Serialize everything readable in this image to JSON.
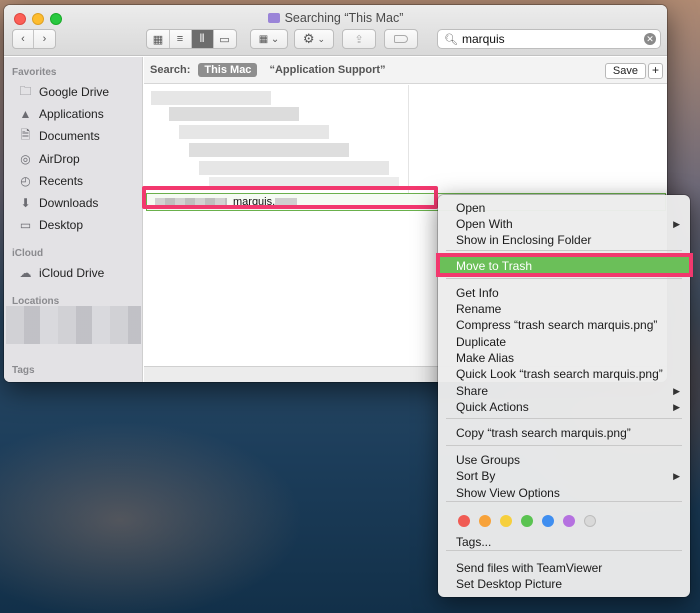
{
  "window": {
    "title": "Searching “This Mac”"
  },
  "search": {
    "value": "marquis",
    "clear_glyph": "✕"
  },
  "scope": {
    "label": "Search:",
    "this_mac": "This Mac",
    "other": "“Application Support”",
    "save": "Save",
    "add": "+"
  },
  "sidebar": {
    "favorites_header": "Favorites",
    "favorites": [
      {
        "label": "Google Drive",
        "icon": "folder-icon"
      },
      {
        "label": "Applications",
        "icon": "applications-icon"
      },
      {
        "label": "Documents",
        "icon": "document-icon"
      },
      {
        "label": "AirDrop",
        "icon": "airdrop-icon"
      },
      {
        "label": "Recents",
        "icon": "clock-icon"
      },
      {
        "label": "Downloads",
        "icon": "download-icon"
      },
      {
        "label": "Desktop",
        "icon": "desktop-icon"
      }
    ],
    "icloud_header": "iCloud",
    "icloud": [
      {
        "label": "iCloud Drive",
        "icon": "cloud-icon"
      }
    ],
    "locations_header": "Locations",
    "tags_header": "Tags"
  },
  "results": {
    "selected_file": "marquis."
  },
  "context_menu": {
    "groups": [
      [
        {
          "label": "Open",
          "submenu": false
        },
        {
          "label": "Open With",
          "submenu": true
        },
        {
          "label": "Show in Enclosing Folder",
          "submenu": false
        }
      ],
      [
        {
          "label": "Move to Trash",
          "submenu": false,
          "highlighted": true
        }
      ],
      [
        {
          "label": "Get Info",
          "submenu": false
        },
        {
          "label": "Rename",
          "submenu": false
        },
        {
          "label": "Compress “trash search marquis.png”",
          "submenu": false
        },
        {
          "label": "Duplicate",
          "submenu": false
        },
        {
          "label": "Make Alias",
          "submenu": false
        },
        {
          "label": "Quick Look “trash search marquis.png”",
          "submenu": false
        },
        {
          "label": "Share",
          "submenu": true
        },
        {
          "label": "Quick Actions",
          "submenu": true
        }
      ],
      [
        {
          "label": "Copy “trash search marquis.png”",
          "submenu": false
        }
      ],
      [
        {
          "label": "Use Groups",
          "submenu": false
        },
        {
          "label": "Sort By",
          "submenu": true
        },
        {
          "label": "Show View Options",
          "submenu": false
        }
      ],
      [
        {
          "label": "Tags...",
          "submenu": false
        }
      ],
      [
        {
          "label": "Send files with TeamViewer",
          "submenu": false
        },
        {
          "label": "Set Desktop Picture",
          "submenu": false
        }
      ]
    ],
    "submenu_glyph": "▶",
    "tag_colors": [
      "#f05b54",
      "#f7a23a",
      "#f6cf3d",
      "#5ac351",
      "#3f8ef0",
      "#b571e0",
      "#d9d9d9"
    ]
  },
  "highlight_color": "#f2386e",
  "menu_highlight_color": "#6bbf59"
}
